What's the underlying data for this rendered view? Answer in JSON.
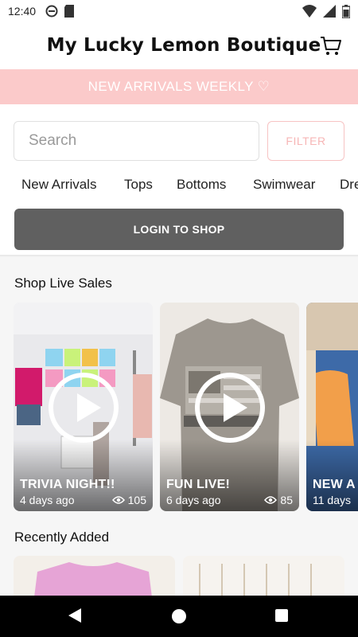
{
  "status_bar": {
    "time": "12:40",
    "icons_left": [
      "sync-icon",
      "sd-card-icon"
    ],
    "icons_right": [
      "wifi-icon",
      "signal-icon",
      "battery-icon"
    ]
  },
  "header": {
    "title": "My Lucky Lemon Boutique",
    "cart_icon": "cart-icon"
  },
  "banner": {
    "text": "NEW ARRIVALS WEEKLY ♡"
  },
  "search": {
    "placeholder": "Search",
    "filter_label": "FILTER"
  },
  "categories": [
    "New Arrivals",
    "Tops",
    "Bottoms",
    "Swimwear",
    "Dre"
  ],
  "login": {
    "label": "LOGIN TO SHOP"
  },
  "live_sales": {
    "title": "Shop Live Sales",
    "items": [
      {
        "title": "TRIVIA NIGHT!!",
        "age": "4 days ago",
        "views": "105"
      },
      {
        "title": "FUN LIVE!",
        "age": "6 days ago",
        "views": "85"
      },
      {
        "title": "NEW A",
        "age": "11 days",
        "views": ""
      }
    ]
  },
  "recently_added": {
    "title": "Recently Added"
  },
  "colors": {
    "banner_bg": "#fbcaca",
    "filter_accent": "#f7b6b6",
    "login_bg": "#606060",
    "nav_bg": "#000000"
  }
}
